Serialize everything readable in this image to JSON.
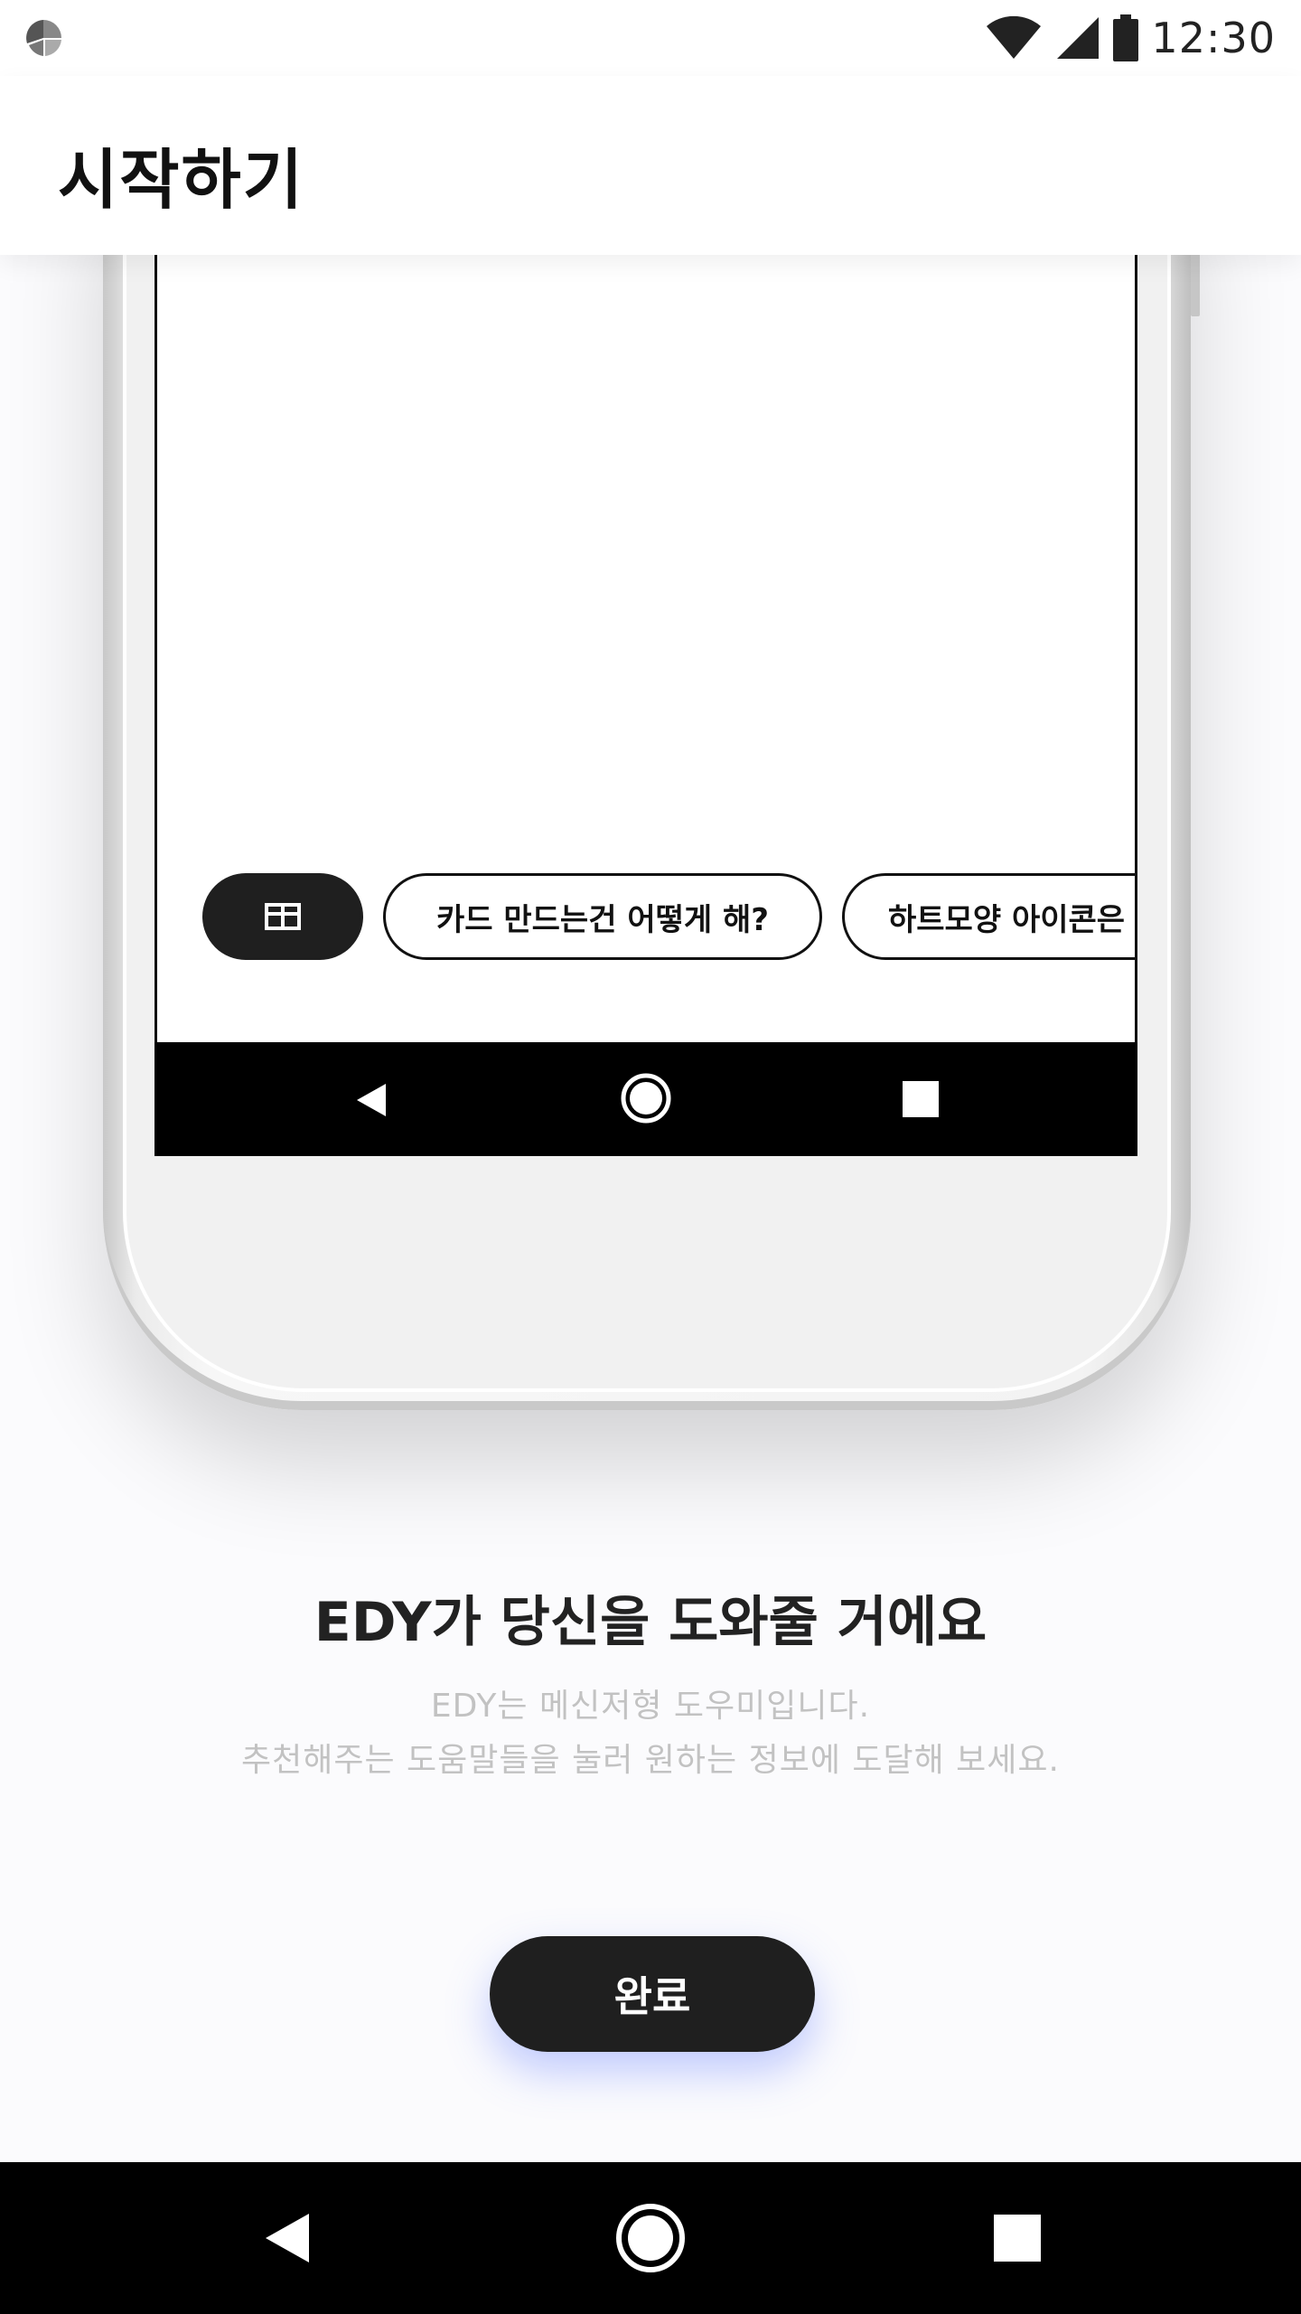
{
  "status_bar": {
    "time": "12:30",
    "icons": [
      "app-icon",
      "wifi-icon",
      "cellular-signal-icon",
      "battery-icon"
    ]
  },
  "app_bar": {
    "title": "시작하기"
  },
  "mockup": {
    "chips": [
      {
        "icon": "grid-icon"
      },
      {
        "label": "카드 만드는건 어떻게 해?"
      },
      {
        "label": "하트모양 아이콘은"
      }
    ],
    "nav_icons": [
      "back-icon",
      "home-icon",
      "recents-icon"
    ]
  },
  "content": {
    "headline": "EDY가 당신을 도와줄 거에요",
    "description_line1": "EDY는 메신저형 도우미입니다.",
    "description_line2": "추천해주는 도움말들을 눌러 원하는 정보에 도달해 보세요."
  },
  "actions": {
    "done_label": "완료"
  },
  "system_nav": {
    "icons": [
      "back-icon",
      "home-icon",
      "recents-icon"
    ]
  },
  "colors": {
    "accent_dark": "#1f1f1f",
    "muted_text": "#c2c2c2",
    "button_glow": "#506eff"
  }
}
